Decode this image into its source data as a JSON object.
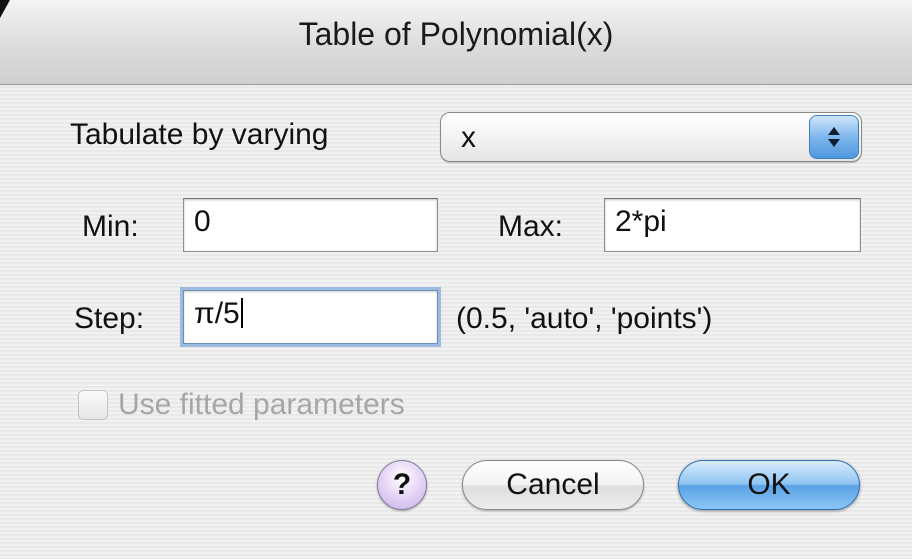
{
  "window": {
    "title": "Table of Polynomial(x)"
  },
  "form": {
    "tabulate_label": "Tabulate by varying",
    "tabulate_value": "x",
    "min_label": "Min:",
    "min_value": "0",
    "max_label": "Max:",
    "max_value": "2*pi",
    "step_label": "Step:",
    "step_value": "π/5",
    "step_hint": "(0.5, 'auto', 'points')",
    "use_fitted_label": "Use fitted parameters",
    "use_fitted_checked": false,
    "use_fitted_enabled": false
  },
  "buttons": {
    "help_label": "?",
    "cancel_label": "Cancel",
    "ok_label": "OK"
  },
  "icons": {
    "popup_arrows": "up-down-chevron-icon",
    "help": "help-icon"
  },
  "colors": {
    "accent": "#5aa2e6",
    "focus_ring": "#9dbbe0",
    "disabled_text": "#a6a6a6"
  }
}
